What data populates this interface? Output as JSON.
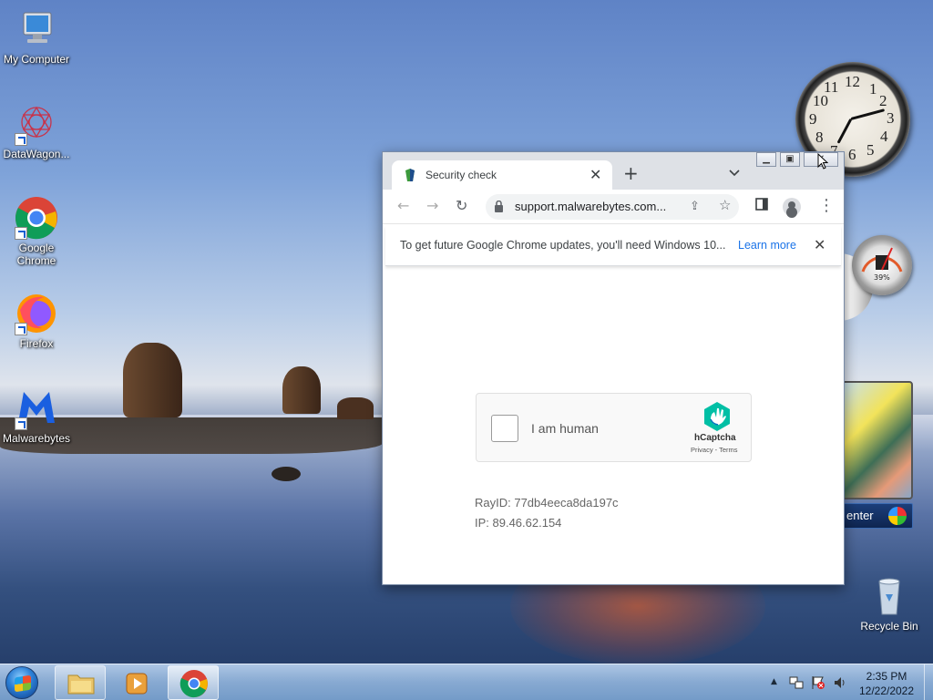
{
  "desktop": {
    "icons": [
      {
        "label": "My Computer"
      },
      {
        "label": "DataWagon..."
      },
      {
        "label": "Google Chrome"
      },
      {
        "label": "Firefox"
      },
      {
        "label": "Malwarebytes"
      },
      {
        "label": "Recycle Bin"
      }
    ]
  },
  "gadgets": {
    "clock_numbers": [
      "12",
      "1",
      "2",
      "3",
      "4",
      "5",
      "6",
      "7",
      "8",
      "9",
      "10",
      "11"
    ],
    "cpu_percent": "39%",
    "media_center_label": "enter"
  },
  "browser": {
    "tab_title": "Security check",
    "close_tab": "✕",
    "new_tab": "+",
    "tab_list": "⌄",
    "url": "support.malwarebytes.com...",
    "infobar": {
      "message": "To get future Google Chrome updates, you'll need Windows 10...",
      "link": "Learn more",
      "close": "✕"
    },
    "captcha": {
      "label": "I am human",
      "brand": "hCaptcha",
      "links": "Privacy - Terms"
    },
    "ray_id": "RayID: 77db4eeca8da197c",
    "ip": "IP: 89.46.62.154"
  },
  "taskbar": {
    "time": "2:35 PM",
    "date": "12/22/2022"
  }
}
